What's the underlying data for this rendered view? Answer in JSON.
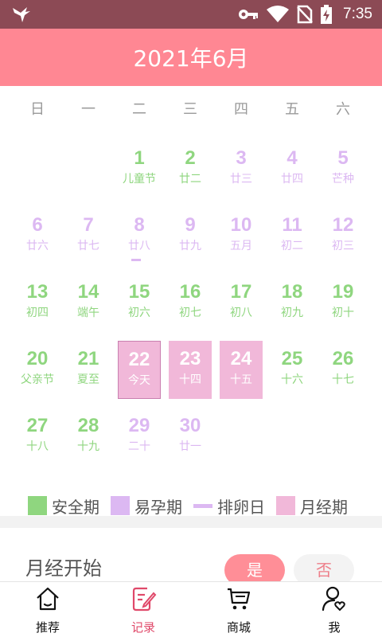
{
  "status_bar": {
    "time": "7:35",
    "icons": [
      "bird-icon",
      "key-icon",
      "wifi-icon",
      "no-sim-icon",
      "battery-charging-icon"
    ]
  },
  "header": {
    "title": "2021年6月"
  },
  "weekdays": [
    "日",
    "一",
    "二",
    "三",
    "四",
    "五",
    "六"
  ],
  "calendar": {
    "weeks": [
      [
        null,
        null,
        {
          "day": "1",
          "lunar": "儿童节",
          "type": "safe"
        },
        {
          "day": "2",
          "lunar": "廿二",
          "type": "safe"
        },
        {
          "day": "3",
          "lunar": "廿三",
          "type": "fertile"
        },
        {
          "day": "4",
          "lunar": "廿四",
          "type": "fertile"
        },
        {
          "day": "5",
          "lunar": "芒种",
          "type": "fertile"
        }
      ],
      [
        {
          "day": "6",
          "lunar": "廿六",
          "type": "fertile"
        },
        {
          "day": "7",
          "lunar": "廿七",
          "type": "fertile"
        },
        {
          "day": "8",
          "lunar": "廿八",
          "type": "fertile",
          "ovulation": true
        },
        {
          "day": "9",
          "lunar": "廿九",
          "type": "fertile"
        },
        {
          "day": "10",
          "lunar": "五月",
          "type": "fertile"
        },
        {
          "day": "11",
          "lunar": "初二",
          "type": "fertile"
        },
        {
          "day": "12",
          "lunar": "初三",
          "type": "fertile"
        }
      ],
      [
        {
          "day": "13",
          "lunar": "初四",
          "type": "safe"
        },
        {
          "day": "14",
          "lunar": "端午",
          "type": "safe"
        },
        {
          "day": "15",
          "lunar": "初六",
          "type": "safe"
        },
        {
          "day": "16",
          "lunar": "初七",
          "type": "safe"
        },
        {
          "day": "17",
          "lunar": "初八",
          "type": "safe"
        },
        {
          "day": "18",
          "lunar": "初九",
          "type": "safe"
        },
        {
          "day": "19",
          "lunar": "初十",
          "type": "safe"
        }
      ],
      [
        {
          "day": "20",
          "lunar": "父亲节",
          "type": "safe"
        },
        {
          "day": "21",
          "lunar": "夏至",
          "type": "safe"
        },
        {
          "day": "22",
          "lunar": "今天",
          "type": "period",
          "today": true
        },
        {
          "day": "23",
          "lunar": "十四",
          "type": "period"
        },
        {
          "day": "24",
          "lunar": "十五",
          "type": "period"
        },
        {
          "day": "25",
          "lunar": "十六",
          "type": "safe"
        },
        {
          "day": "26",
          "lunar": "十七",
          "type": "safe"
        }
      ],
      [
        {
          "day": "27",
          "lunar": "十八",
          "type": "safe"
        },
        {
          "day": "28",
          "lunar": "十九",
          "type": "safe"
        },
        {
          "day": "29",
          "lunar": "二十",
          "type": "fertile"
        },
        {
          "day": "30",
          "lunar": "廿一",
          "type": "fertile"
        },
        null,
        null,
        null
      ]
    ]
  },
  "legend": {
    "safe": "安全期",
    "fertile": "易孕期",
    "ovulation": "排卵日",
    "period": "月经期"
  },
  "period_start": {
    "label": "月经开始",
    "yes": "是",
    "no": "否"
  },
  "bottom_nav": [
    {
      "label": "推荐",
      "icon": "home-icon"
    },
    {
      "label": "记录",
      "icon": "record-icon",
      "active": true
    },
    {
      "label": "商城",
      "icon": "cart-icon"
    },
    {
      "label": "我",
      "icon": "profile-icon"
    }
  ],
  "colors": {
    "header": "#ff8793",
    "status_bar": "#8c4a55",
    "safe": "#8fd67f",
    "fertile": "#dcb8f2",
    "period": "#f1b8d9",
    "active_nav": "#e0496a"
  }
}
